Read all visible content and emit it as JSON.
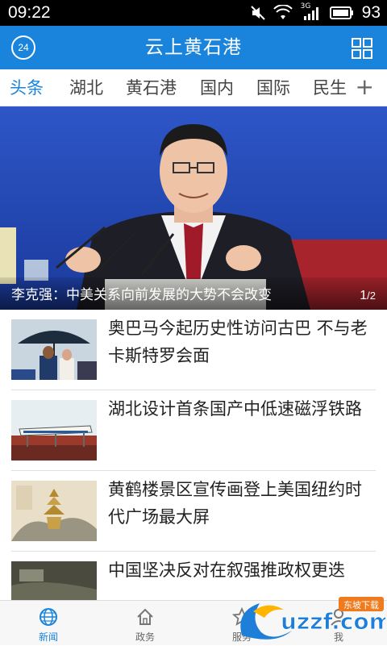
{
  "status_bar": {
    "time": "09:22",
    "battery": "93",
    "network": "3G"
  },
  "app_bar": {
    "badge": "24",
    "title": "云上黄石港"
  },
  "tabs": [
    {
      "label": "头条",
      "active": true
    },
    {
      "label": "湖北"
    },
    {
      "label": "黄石港"
    },
    {
      "label": "国内"
    },
    {
      "label": "国际"
    },
    {
      "label": "民生"
    }
  ],
  "tab_add": "+",
  "hero": {
    "caption": "李克强：中美关系向前发展的大势不会改变",
    "page_current": "1",
    "page_total": "2"
  },
  "news": [
    {
      "title": "奥巴马今起历史性访问古巴 不与老卡斯特罗会面"
    },
    {
      "title": "湖北设计首条国产中低速磁浮铁路"
    },
    {
      "title": "黄鹤楼景区宣传画登上美国纽约时代广场最大屏"
    },
    {
      "title": "中国坚决反对在叙强推政权更迭"
    }
  ],
  "bottom_nav": [
    {
      "label": "新闻",
      "icon": "globe-icon",
      "active": true
    },
    {
      "label": "政务",
      "icon": "home-icon"
    },
    {
      "label": "服务",
      "icon": "star-icon"
    },
    {
      "label": "我",
      "icon": "person-icon"
    }
  ],
  "watermark": {
    "text": "uzzf.com",
    "tag": "东坡下载"
  },
  "colors": {
    "accent": "#1a84dc",
    "status_bar": "#000000"
  }
}
